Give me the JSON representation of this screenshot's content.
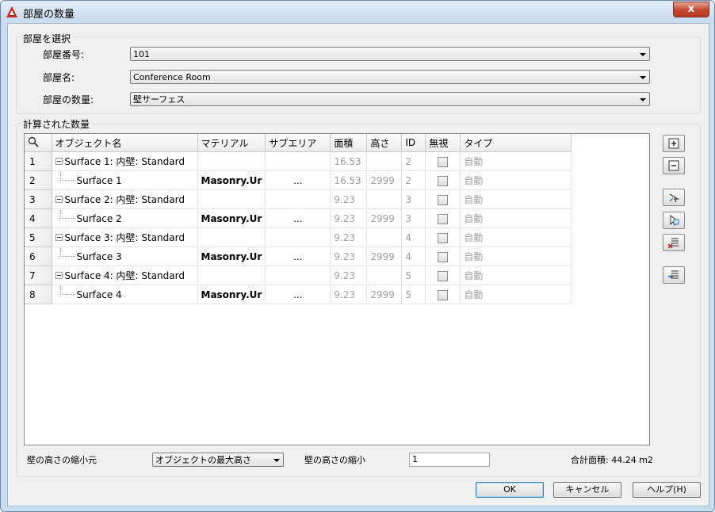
{
  "window": {
    "title": "部屋の数量",
    "close_label": "x"
  },
  "select_group": {
    "label": "部屋を選択",
    "room_number_label": "部屋番号:",
    "room_number_value": "101",
    "room_name_label": "部屋名:",
    "room_name_value": "Conference Room",
    "quantity_label": "部屋の数量:",
    "quantity_value": "壁サーフェス"
  },
  "computed_group": {
    "label": "計算された数量"
  },
  "table": {
    "columns": [
      "オブジェクト名",
      "マテリアル",
      "サブエリア",
      "面積",
      "高さ",
      "ID",
      "無視",
      "タイプ"
    ],
    "rows": [
      {
        "num": "1",
        "name": "Surface 1: 内壁: Standard",
        "material": "",
        "subarea": "",
        "area": "16.53",
        "height": "",
        "id": "2",
        "type": "自動"
      },
      {
        "num": "2",
        "name": "Surface 1",
        "material": "Masonry.Ur",
        "subarea": "...",
        "area": "16.53",
        "height": "2999",
        "id": "2",
        "type": "自動"
      },
      {
        "num": "3",
        "name": "Surface 2: 内壁: Standard",
        "material": "",
        "subarea": "",
        "area": "9.23",
        "height": "",
        "id": "3",
        "type": "自動"
      },
      {
        "num": "4",
        "name": "Surface 2",
        "material": "Masonry.Ur",
        "subarea": "...",
        "area": "9.23",
        "height": "2999",
        "id": "3",
        "type": "自動"
      },
      {
        "num": "5",
        "name": "Surface 3: 内壁: Standard",
        "material": "",
        "subarea": "",
        "area": "9.23",
        "height": "",
        "id": "4",
        "type": "自動"
      },
      {
        "num": "6",
        "name": "Surface 3",
        "material": "Masonry.Ur",
        "subarea": "...",
        "area": "9.23",
        "height": "2999",
        "id": "4",
        "type": "自動"
      },
      {
        "num": "7",
        "name": "Surface 4: 内壁: Standard",
        "material": "",
        "subarea": "",
        "area": "9.23",
        "height": "",
        "id": "5",
        "type": "自動"
      },
      {
        "num": "8",
        "name": "Surface 4",
        "material": "Masonry.Ur",
        "subarea": "...",
        "area": "9.23",
        "height": "2999",
        "id": "5",
        "type": "自動"
      }
    ]
  },
  "bottom": {
    "wall_height_source_label": "壁の高さの縮小元",
    "wall_height_source_value": "オブジェクトの最大高さ",
    "wall_height_reduction_label": "壁の高さの縮小",
    "wall_height_reduction_value": "1",
    "total_area": "合計面積: 44.24 m2"
  },
  "buttons": {
    "ok": "OK",
    "cancel": "キャンセル",
    "help": "ヘルプ(H)"
  },
  "icons": {
    "app": "autocad-logo-icon",
    "search": "search-icon",
    "expand": "expand-all-icon",
    "collapse": "collapse-all-icon",
    "select": "select-objects-icon",
    "add": "add-objects-icon",
    "remove": "remove-objects-icon",
    "export": "export-list-icon"
  },
  "colors": {
    "title_gradient_top": "#e4eef9",
    "close_button": "#c4462f",
    "muted_text": "#a0a0a0",
    "logo_red": "#c8271c"
  }
}
